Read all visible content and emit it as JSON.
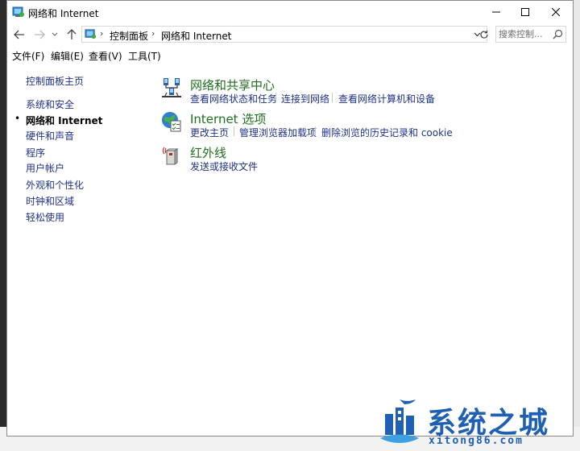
{
  "window": {
    "title": "网络和 Internet"
  },
  "address": {
    "crumbs": [
      "控制面板",
      "网络和 Internet"
    ],
    "search_placeholder": "搜索控制..."
  },
  "menu": [
    "文件(F)",
    "编辑(E)",
    "查看(V)",
    "工具(T)"
  ],
  "sidebar": {
    "home": "控制面板主页",
    "items": [
      "系统和安全",
      "网络和 Internet",
      "硬件和声音",
      "程序",
      "用户帐户",
      "外观和个性化",
      "时钟和区域",
      "轻松使用"
    ],
    "current_index": 1
  },
  "categories": [
    {
      "title": "网络和共享中心",
      "icon": "network-sharing-icon",
      "tasks": [
        "查看网络状态和任务",
        "连接到网络",
        "查看网络计算机和设备"
      ]
    },
    {
      "title": "Internet 选项",
      "icon": "internet-options-icon",
      "tasks": [
        "更改主页",
        "管理浏览器加载项",
        "删除浏览的历史记录和 cookie"
      ]
    },
    {
      "title": "红外线",
      "icon": "infrared-icon",
      "tasks": [
        "发送或接收文件"
      ]
    }
  ],
  "watermark": {
    "name": "系统之城",
    "url": "xitong86.com"
  },
  "colors": {
    "link": "#1e3287",
    "category_title": "#1e6e1e",
    "watermark": "#1f5fb4"
  }
}
